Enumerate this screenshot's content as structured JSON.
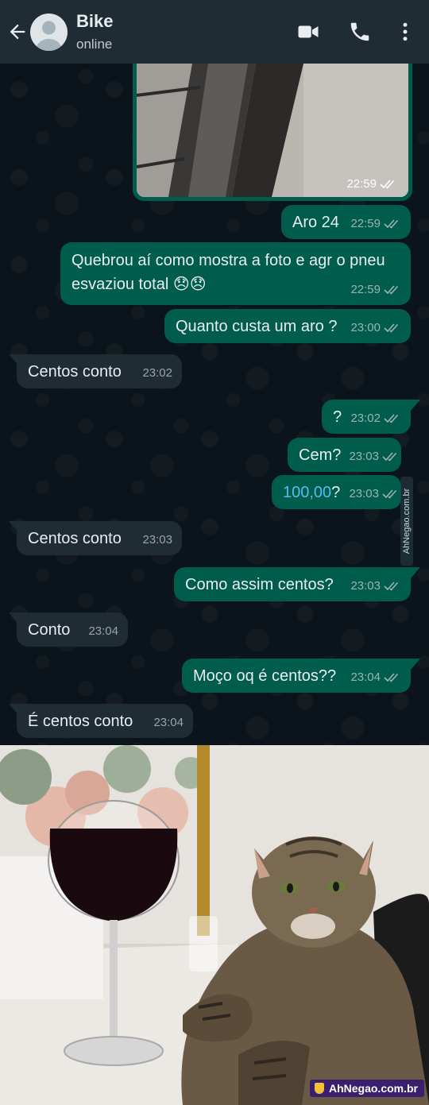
{
  "header": {
    "contact_name": "Bike",
    "status": "online",
    "colors": {
      "bar": "#1f2c34",
      "accent": "#005c4b"
    },
    "icons": [
      "back-arrow-icon",
      "avatar-icon",
      "video-call-icon",
      "phone-icon",
      "more-vert-icon"
    ]
  },
  "messages": [
    {
      "dir": "out",
      "kind": "photo",
      "time": "22:59",
      "ticks": "double-check-icon"
    },
    {
      "dir": "out",
      "text": "Aro 24",
      "time": "22:59"
    },
    {
      "dir": "out",
      "line1": "Quebrou aí como mostra a foto e agr o pneu",
      "line2": "esvaziou total 😞😞",
      "time": "22:59"
    },
    {
      "dir": "out",
      "text": "Quanto custa um aro ?",
      "time": "23:00"
    },
    {
      "dir": "in",
      "text": "Centos conto",
      "time": "23:02"
    },
    {
      "dir": "out",
      "text": "?",
      "time": "23:02"
    },
    {
      "dir": "out",
      "text": "Cem?",
      "time": "23:03"
    },
    {
      "dir": "out",
      "text_link": "100,00",
      "text_tail": "?",
      "time": "23:03"
    },
    {
      "dir": "in",
      "text": "Centos conto",
      "time": "23:03"
    },
    {
      "dir": "out",
      "text": "Como assim centos?",
      "time": "23:03"
    },
    {
      "dir": "in",
      "text": "Conto",
      "time": "23:04"
    },
    {
      "dir": "out",
      "text": "Moço oq é centos??",
      "time": "23:04"
    },
    {
      "dir": "in",
      "text": "É centos conto",
      "time": "23:04"
    }
  ],
  "watermark_side": "AhNegao.com.br",
  "meme": {
    "badge": "AhNegao.com.br"
  }
}
